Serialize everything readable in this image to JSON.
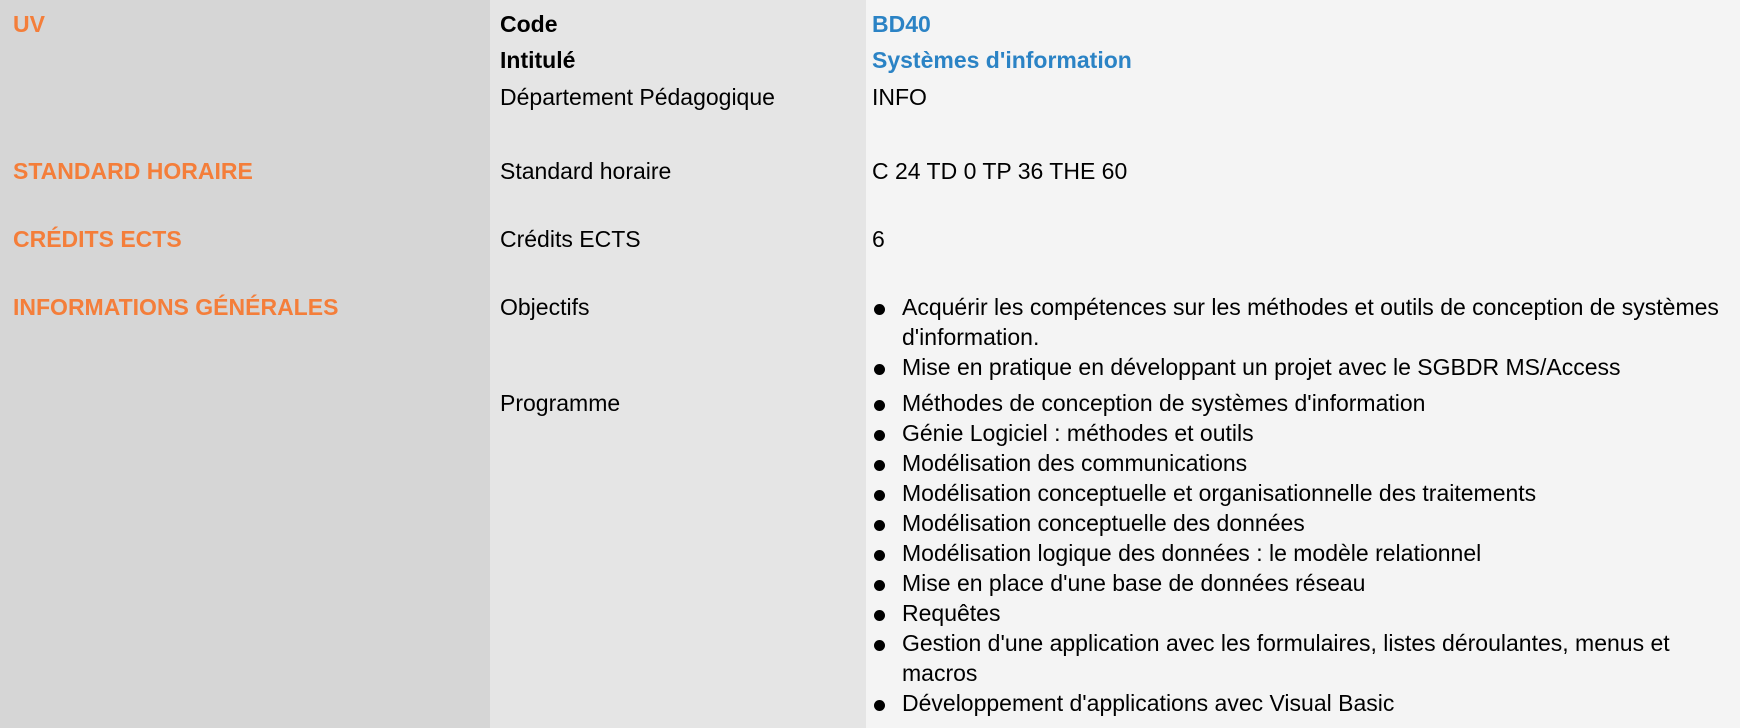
{
  "sections": {
    "uv": "UV",
    "standard_horaire": "STANDARD HORAIRE",
    "credits_ects": "CRÉDITS ECTS",
    "informations_generales": "INFORMATIONS GÉNÉRALES"
  },
  "labels": {
    "code": "Code",
    "intitule": "Intitulé",
    "departement": "Département Pédagogique",
    "standard_horaire": "Standard horaire",
    "credits_ects": "Crédits ECTS",
    "objectifs": "Objectifs",
    "programme": "Programme"
  },
  "values": {
    "code": "BD40",
    "intitule": "Systèmes d'information",
    "departement": "INFO",
    "standard_horaire": "C 24 TD 0 TP 36 THE 60",
    "credits_ects": "6"
  },
  "objectifs": [
    "Acquérir les compétences sur les méthodes et outils de conception de systèmes d'information.",
    "Mise en pratique en développant un projet avec le SGBDR MS/Access"
  ],
  "programme": [
    "Méthodes de conception de systèmes d'information",
    "Génie Logiciel : méthodes et outils",
    "Modélisation des communications",
    "Modélisation conceptuelle et organisationnelle des traitements",
    "Modélisation conceptuelle des données",
    "Modélisation logique des données : le modèle relationnel",
    "Mise en place d'une base de données réseau",
    "Requêtes",
    "Gestion d'une application avec les formulaires, listes déroulantes, menus et macros",
    "Développement d'applications avec Visual Basic"
  ],
  "colors": {
    "section_heading": "#f47e3a",
    "highlight_value": "#2b83c5",
    "col_a_bg": "#d6d6d6",
    "col_b_bg": "#e5e5e5",
    "col_c_bg": "#f4f4f4"
  }
}
